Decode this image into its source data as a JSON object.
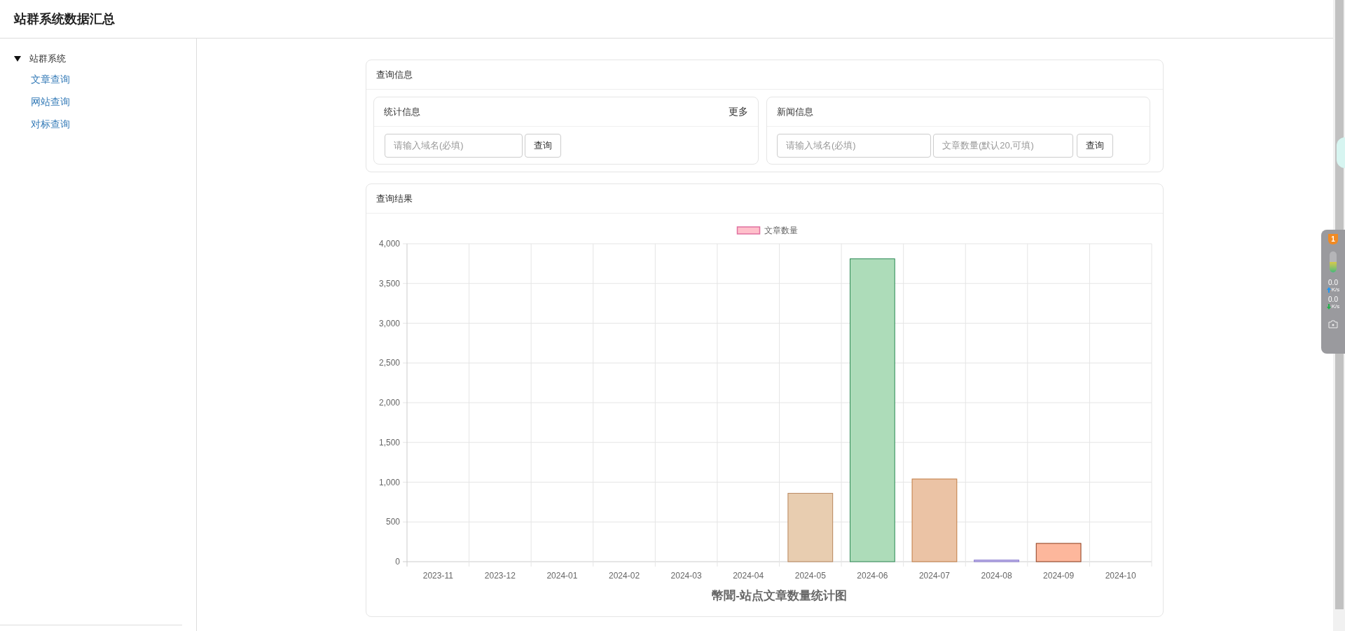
{
  "header": {
    "title": "站群系统数据汇总"
  },
  "sidebar": {
    "items": [
      {
        "label": "站群系统",
        "expanded": true,
        "children": [
          {
            "label": "文章查询"
          },
          {
            "label": "网站查询"
          },
          {
            "label": "对标查询"
          }
        ]
      }
    ]
  },
  "query_panel": {
    "title": "查询信息",
    "stats": {
      "title": "统计信息",
      "more_link": "更多",
      "domain_field": {
        "placeholder": "请输入域名(必填)"
      },
      "button": "查询"
    },
    "news": {
      "title": "新闻信息",
      "domain_field": {
        "placeholder": "请输入域名(必填)"
      },
      "count_field": {
        "placeholder": "文章数量(默认20,可填)"
      },
      "button": "查询"
    }
  },
  "result_panel": {
    "title": "查询结果",
    "chart_data": {
      "type": "bar",
      "title": "幣聞-站点文章数量统计图",
      "categories": [
        "2023-11",
        "2023-12",
        "2024-01",
        "2024-02",
        "2024-03",
        "2024-04",
        "2024-05",
        "2024-06",
        "2024-07",
        "2024-08",
        "2024-09",
        "2024-10"
      ],
      "series": [
        {
          "name": "文章数量",
          "values": [
            0,
            0,
            0,
            0,
            0,
            0,
            860,
            3810,
            1040,
            20,
            230,
            0
          ]
        }
      ],
      "grid": true,
      "ylim": [
        0,
        4000
      ],
      "yticks": [
        {
          "value": 0,
          "label": "0"
        },
        {
          "value": 500,
          "label": "500"
        },
        {
          "value": 1000,
          "label": "1,000"
        },
        {
          "value": 1500,
          "label": "1,500"
        },
        {
          "value": 2000,
          "label": "2,000"
        },
        {
          "value": 2500,
          "label": "2,500"
        },
        {
          "value": 3000,
          "label": "3,000"
        },
        {
          "value": 3500,
          "label": "3,500"
        },
        {
          "value": 4000,
          "label": "4,000"
        }
      ]
    }
  },
  "overlay_widget": {
    "badge": "1",
    "upload_rate": "0.0",
    "upload_unit": "K/s",
    "download_rate": "0.0",
    "download_unit": "K/s"
  }
}
